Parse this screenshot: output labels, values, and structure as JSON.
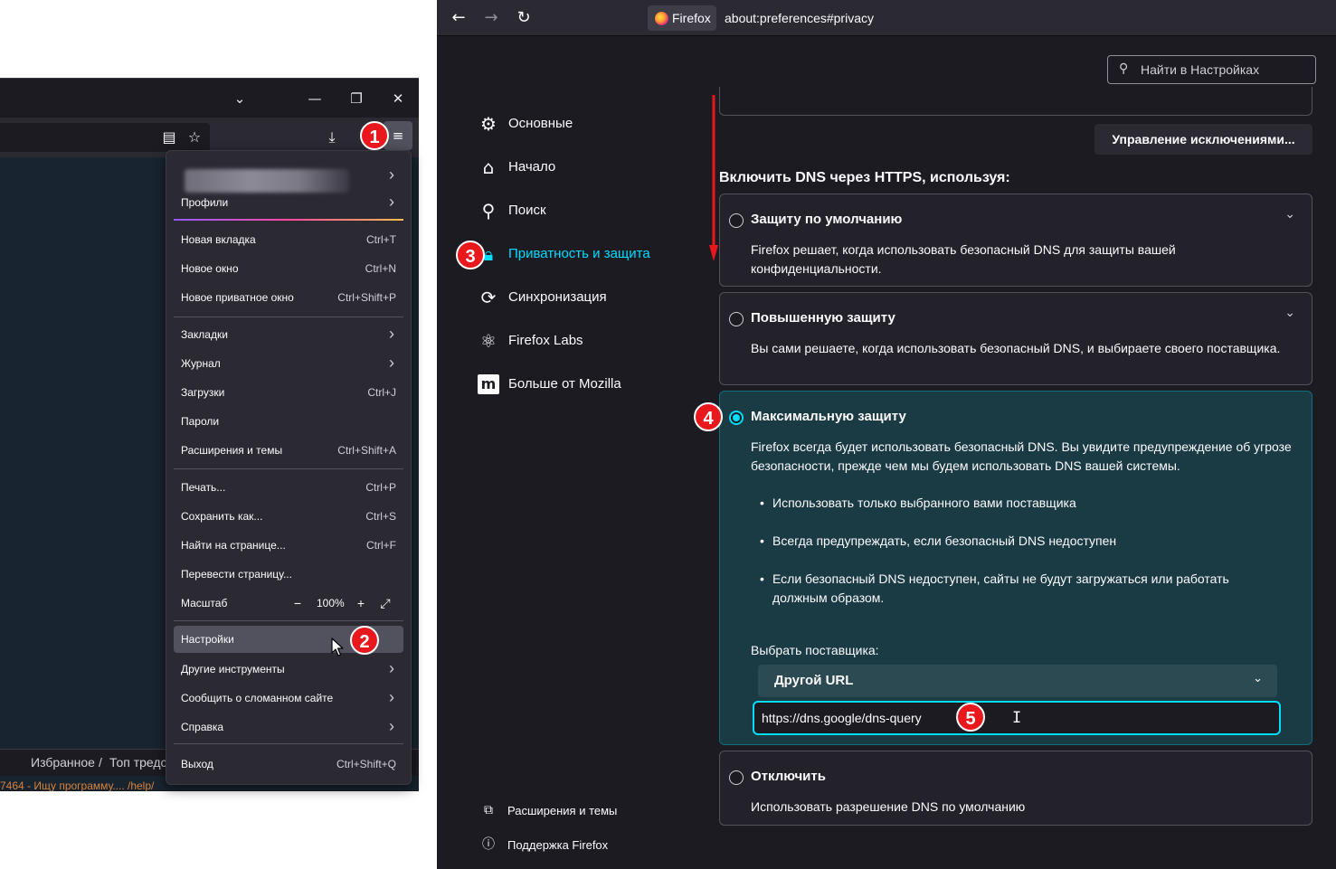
{
  "left": {
    "menu": {
      "profiles": "Профили",
      "new_tab": {
        "label": "Новая вкладка",
        "shortcut": "Ctrl+T"
      },
      "new_window": {
        "label": "Новое окно",
        "shortcut": "Ctrl+N"
      },
      "new_private": {
        "label": "Новое приватное окно",
        "shortcut": "Ctrl+Shift+P"
      },
      "bookmarks": "Закладки",
      "history": "Журнал",
      "downloads": {
        "label": "Загрузки",
        "shortcut": "Ctrl+J"
      },
      "passwords": "Пароли",
      "addons": {
        "label": "Расширения и темы",
        "shortcut": "Ctrl+Shift+A"
      },
      "print": {
        "label": "Печать...",
        "shortcut": "Ctrl+P"
      },
      "save_as": {
        "label": "Сохранить как...",
        "shortcut": "Ctrl+S"
      },
      "find": {
        "label": "Найти на странице...",
        "shortcut": "Ctrl+F"
      },
      "translate": "Перевести страницу...",
      "zoom": {
        "label": "Масштаб",
        "value": "100%",
        "minus": "−",
        "plus": "+"
      },
      "settings": "Настройки",
      "more_tools": "Другие инструменты",
      "report_site": "Сообщить о сломанном сайте",
      "help": "Справка",
      "exit": {
        "label": "Выход",
        "shortcut": "Ctrl+Shift+Q"
      }
    },
    "bookmarks_bar": {
      "item1": "Избранное",
      "sep": "/",
      "item2": "Топ тредс"
    },
    "footer_link": "7464 - Ищу программу.... /help/"
  },
  "right": {
    "url_identity": "Firefox",
    "url": "about:preferences#privacy",
    "search_placeholder": "Найти в Настройках",
    "categories": [
      {
        "label": "Основные"
      },
      {
        "label": "Начало"
      },
      {
        "label": "Поиск"
      },
      {
        "label": "Приватность и защита"
      },
      {
        "label": "Синхронизация"
      },
      {
        "label": "Firefox Labs"
      },
      {
        "label": "Больше от Mozilla"
      }
    ],
    "footer": {
      "addons": "Расширения и темы",
      "support": "Поддержка Firefox"
    },
    "exceptions_button": "Управление исключениями...",
    "doh_heading": "Включить DNS через HTTPS, используя:",
    "options": {
      "default": {
        "title": "Защиту по умолчанию",
        "desc": "Firefox решает, когда использовать безопасный DNS для защиты вашей конфиденциальности."
      },
      "increased": {
        "title": "Повышенную защиту",
        "desc": "Вы сами решаете, когда использовать безопасный DNS, и выбираете своего поставщика."
      },
      "max": {
        "title": "Максимальную защиту",
        "desc": "Firefox всегда будет использовать безопасный DNS. Вы увидите предупреждение об угрозе безопасности, прежде чем мы будем использовать DNS вашей системы.",
        "bullets": [
          "Использовать только выбранного вами поставщика",
          "Всегда предупреждать, если безопасный DNS недоступен",
          "Если безопасный DNS недоступен, сайты не будут загружаться или работать должным образом."
        ],
        "provider_label": "Выбрать поставщика:",
        "provider_value": "Другой URL",
        "custom_url": "https://dns.google/dns-query"
      },
      "off": {
        "title": "Отключить",
        "desc": "Использовать разрешение DNS по умолчанию"
      }
    }
  },
  "annotations": {
    "b1": "1",
    "b2": "2",
    "b3": "3",
    "b4": "4",
    "b5": "5"
  },
  "colors": {
    "accent": "#00ddff",
    "badge": "#e8181d",
    "menu_bg": "#2b2a33",
    "page_bg": "#1c1b22"
  }
}
